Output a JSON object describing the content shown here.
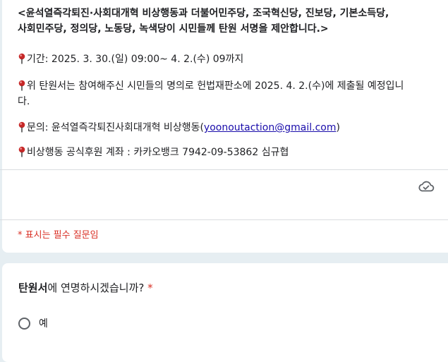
{
  "header": {
    "line1": "<윤석열즉각퇴진·사회대개혁 비상행동과 더불어민주당, 조국혁신당, 진보당, 기본소득당,",
    "line2": "사회민주당, 정의당, 노동당, 녹색당이 시민들께 탄원 서명을 제안합니다.>"
  },
  "info": {
    "period": "기간: 2025. 3. 30.(일) 09:00~ 4. 2.(수) 09까지",
    "submit_line1": "위 탄원서는 참여해주신 시민들의 명의로 헌법재판소에 2025. 4. 2.(수)에 제출될 예정입니",
    "submit_line2": "다.",
    "contact_prefix": "문의: 윤석열즉각퇴진사회대개혁 비상행동(",
    "contact_email": "yoonoutaction@gmail.com",
    "contact_suffix": ")",
    "account": "비상행동 공식후원 계좌 : 카카오뱅크 7942-09-53862 심규협"
  },
  "required_note": "* 표시는 필수 질문임",
  "question": {
    "bold_part": "탄원서",
    "rest": "에 연명하시겠습니까?",
    "required_mark": " *",
    "option_label": "예"
  },
  "icons": {
    "pin": "pushpin-icon",
    "cloud": "cloud-saved-icon"
  },
  "colors": {
    "required": "#d93025",
    "link": "#1a0dab",
    "background": "#e6eef2"
  }
}
